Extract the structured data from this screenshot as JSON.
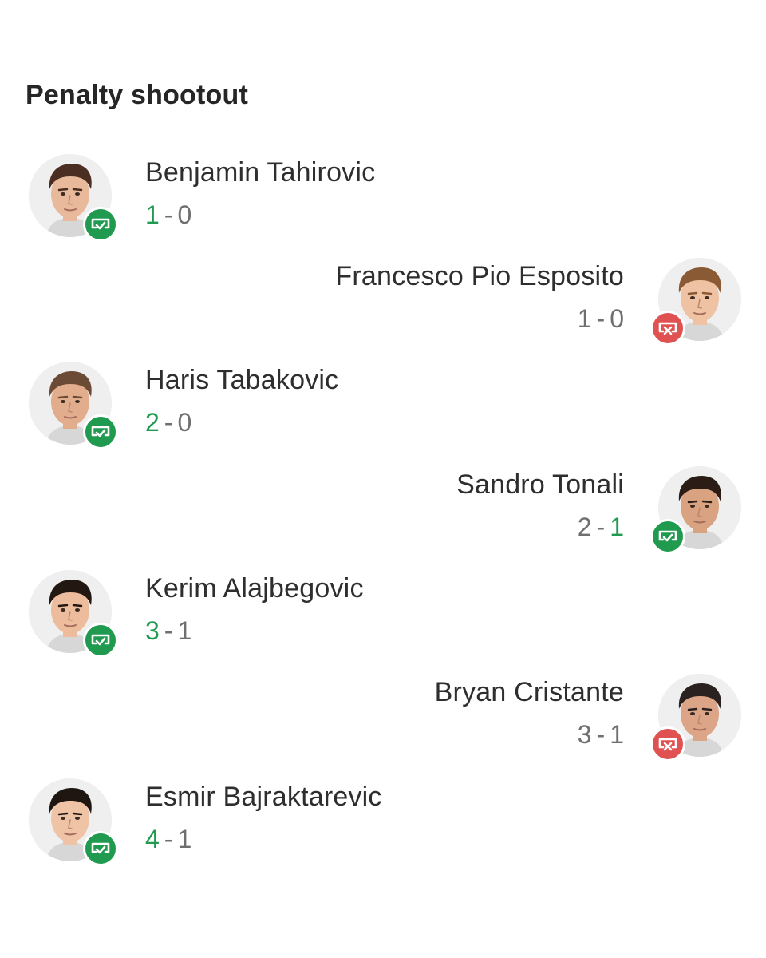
{
  "title": "Penalty shootout",
  "colors": {
    "scored": "#1f9a4f",
    "missed": "#e05252",
    "score_text": "#6f6f6f"
  },
  "kicks": [
    {
      "name": "Benjamin Tahirovic",
      "side": "left",
      "result": "scored",
      "home": "1",
      "away": "0",
      "badge_icon": "goal-scored-icon"
    },
    {
      "name": "Francesco Pio Esposito",
      "side": "right",
      "result": "missed",
      "home": "1",
      "away": "0",
      "badge_icon": "goal-missed-icon"
    },
    {
      "name": "Haris Tabakovic",
      "side": "left",
      "result": "scored",
      "home": "2",
      "away": "0",
      "badge_icon": "goal-scored-icon"
    },
    {
      "name": "Sandro Tonali",
      "side": "right",
      "result": "scored",
      "home": "2",
      "away": "1",
      "badge_icon": "goal-scored-icon"
    },
    {
      "name": "Kerim Alajbegovic",
      "side": "left",
      "result": "scored",
      "home": "3",
      "away": "1",
      "badge_icon": "goal-scored-icon"
    },
    {
      "name": "Bryan Cristante",
      "side": "right",
      "result": "missed",
      "home": "3",
      "away": "1",
      "badge_icon": "goal-missed-icon"
    },
    {
      "name": "Esmir Bajraktarevic",
      "side": "left",
      "result": "scored",
      "home": "4",
      "away": "1",
      "badge_icon": "goal-scored-icon"
    }
  ]
}
